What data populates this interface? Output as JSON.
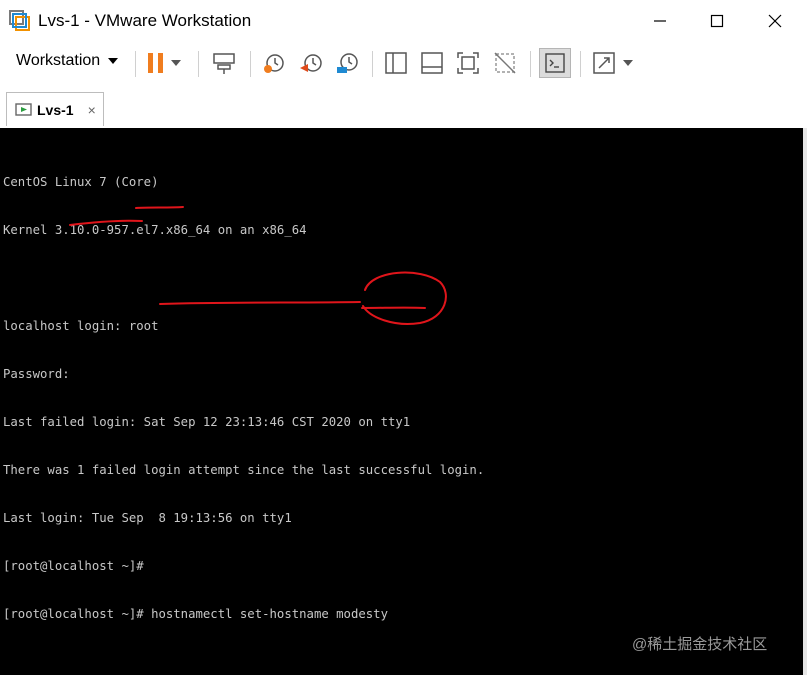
{
  "window": {
    "title": "Lvs-1 - VMware Workstation",
    "minimize_glyph": "—",
    "maximize_glyph": "☐",
    "close_glyph": "✕"
  },
  "toolbar": {
    "menu_label": "Workstation",
    "icons": [
      "pause-icon",
      "send-ctrl-alt-del-icon",
      "snapshot-take-icon",
      "snapshot-revert-icon",
      "snapshot-manager-icon",
      "library-view-icon",
      "thumbnail-view-icon",
      "full-screen-icon",
      "unity-icon",
      "console-view-icon",
      "stretch-guest-icon"
    ]
  },
  "tabs": [
    {
      "label": "Lvs-1",
      "close": "×"
    }
  ],
  "terminal": {
    "lines": [
      "CentOS Linux 7 (Core)",
      "Kernel 3.10.0-957.el7.x86_64 on an x86_64",
      "",
      "localhost login: root",
      "Password:",
      "Last failed login: Sat Sep 12 23:13:46 CST 2020 on tty1",
      "There was 1 failed login attempt since the last successful login.",
      "Last login: Tue Sep  8 19:13:56 on tty1",
      "[root@localhost ~]#",
      "[root@localhost ~]# hostnamectl set-hostname modesty"
    ]
  },
  "annotation_color": "#e0151b",
  "watermark": "@稀土掘金技术社区"
}
